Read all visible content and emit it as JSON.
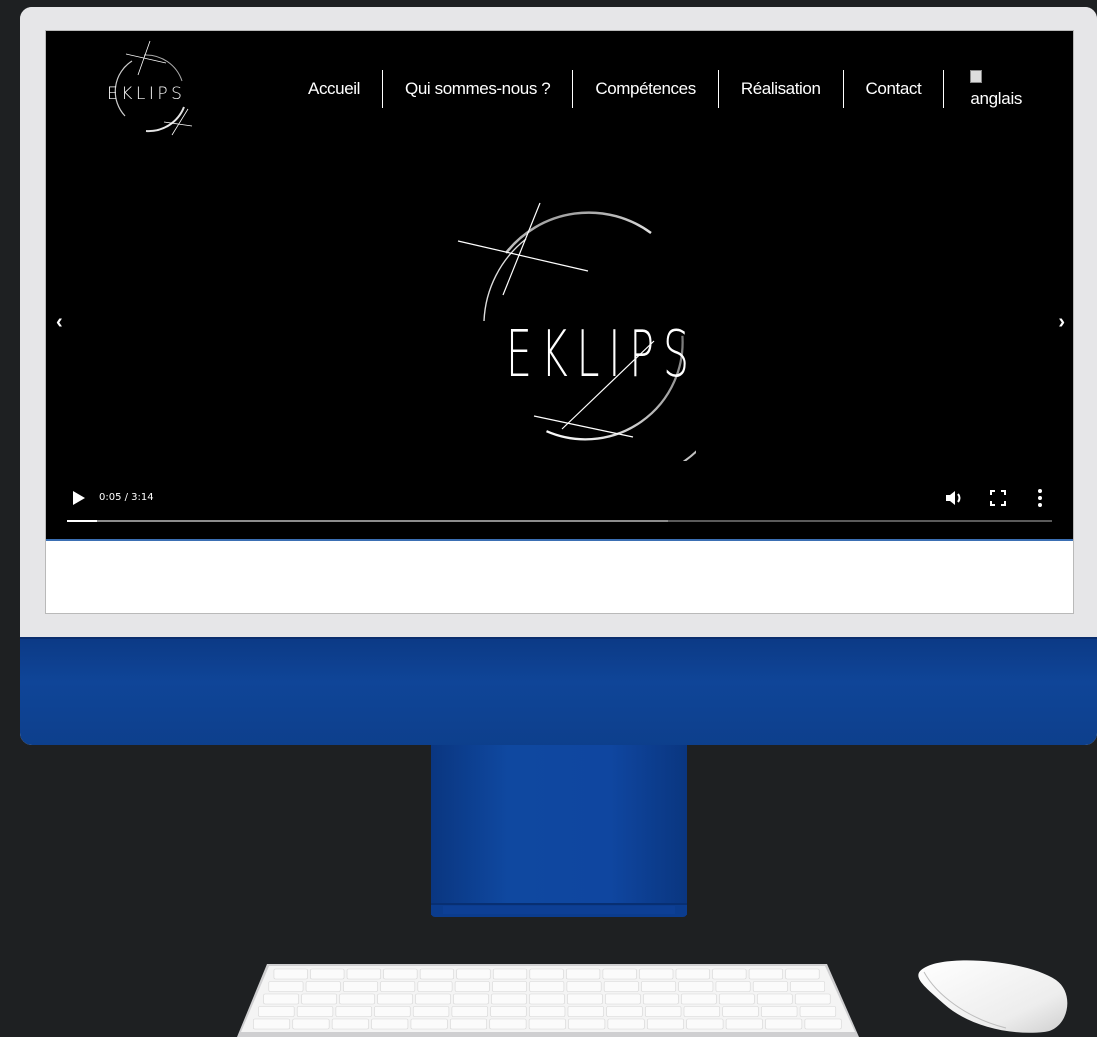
{
  "nav": {
    "items": [
      {
        "label": "Accueil"
      },
      {
        "label": "Qui sommes-nous ?"
      },
      {
        "label": "Compétences"
      },
      {
        "label": "Réalisation"
      },
      {
        "label": "Contact"
      }
    ],
    "language_alt": "anglais"
  },
  "logo": {
    "text": "EKLIPS"
  },
  "hero": {
    "text": "EKLIPS"
  },
  "carousel": {
    "prev_label": "‹",
    "next_label": "›"
  },
  "video": {
    "time_label": "0:05 / 3:14",
    "progress": 0.03,
    "buffered": 0.61
  },
  "colors": {
    "device_blue": "#0f4598",
    "bezel": "#e6e6e8",
    "background": "#1e2022"
  }
}
